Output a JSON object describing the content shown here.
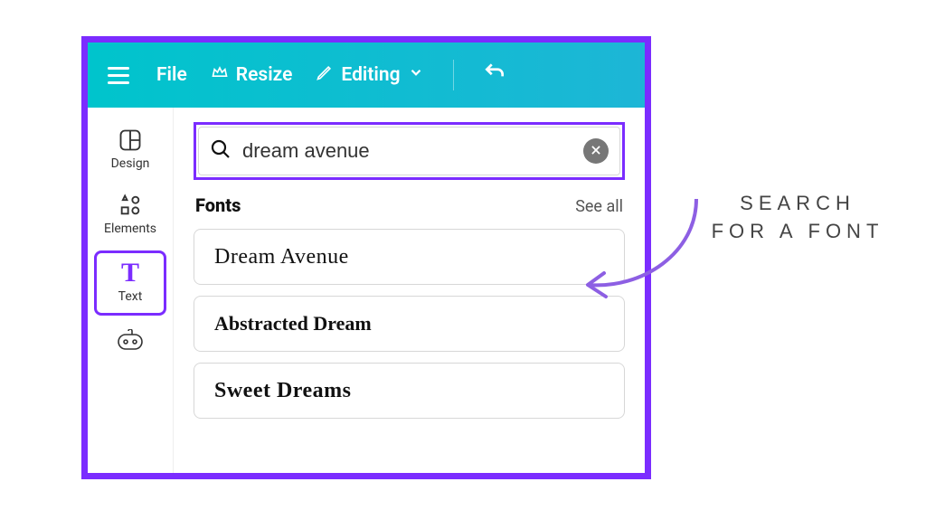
{
  "topbar": {
    "file_label": "File",
    "resize_label": "Resize",
    "editing_label": "Editing"
  },
  "sidebar": {
    "items": [
      {
        "label": "Design"
      },
      {
        "label": "Elements"
      },
      {
        "label": "Text"
      }
    ]
  },
  "search": {
    "value": "dream avenue"
  },
  "fonts_section": {
    "title": "Fonts",
    "see_all": "See all",
    "results": [
      {
        "name": "Dream Avenue"
      },
      {
        "name": "Abstracted Dream"
      },
      {
        "name": "Sweet Dreams"
      }
    ]
  },
  "annotation": {
    "line1": "SEARCH",
    "line2": "FOR A FONT"
  },
  "colors": {
    "accent": "#7b2cff",
    "topbar_start": "#00c4cc",
    "topbar_end": "#1db6d6"
  }
}
